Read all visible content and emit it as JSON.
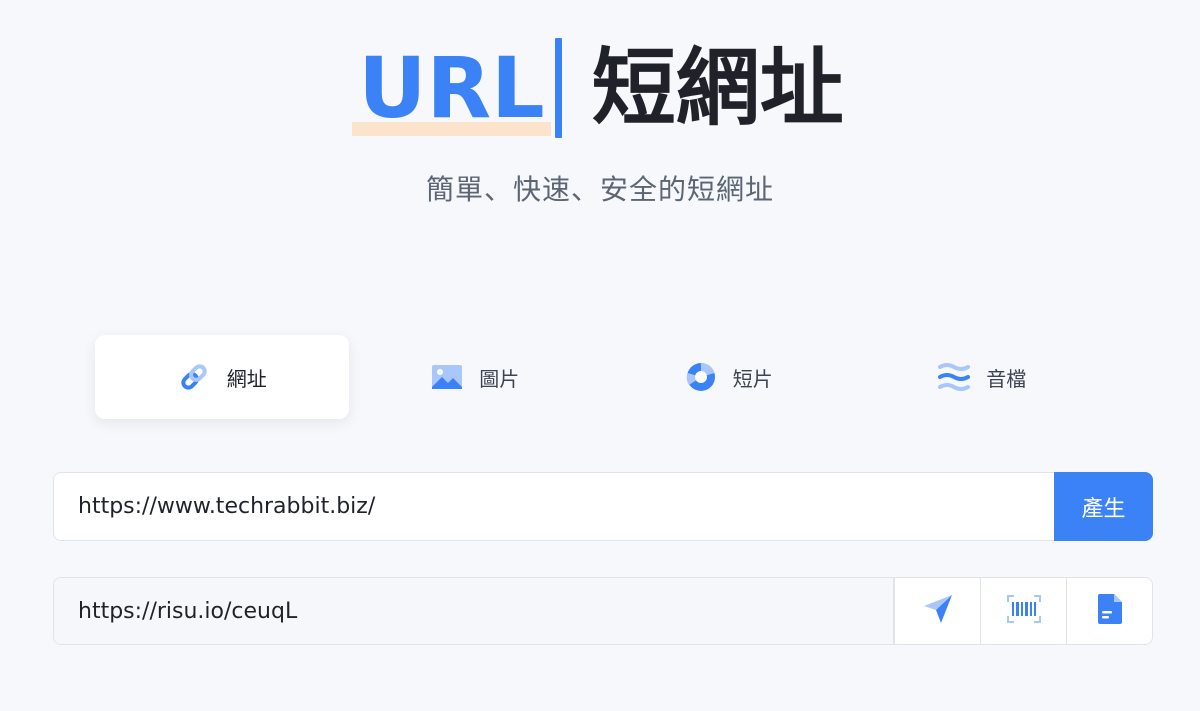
{
  "hero": {
    "title_prefix": "URL",
    "title_main": "短網址",
    "subtitle": "簡單、快速、安全的短網址"
  },
  "tabs": [
    {
      "label": "網址",
      "icon": "link-icon",
      "active": true
    },
    {
      "label": "圖片",
      "icon": "image-icon",
      "active": false
    },
    {
      "label": "短片",
      "icon": "video-icon",
      "active": false
    },
    {
      "label": "音檔",
      "icon": "audio-icon",
      "active": false
    }
  ],
  "form": {
    "url_value": "https://www.techrabbit.biz/",
    "generate_label": "產生"
  },
  "result": {
    "short_url": "https://risu.io/ceuqL",
    "actions": [
      {
        "icon": "send-icon"
      },
      {
        "icon": "barcode-icon"
      },
      {
        "icon": "document-icon"
      }
    ]
  },
  "colors": {
    "accent": "#3b82f6",
    "accent_light": "#a9c7fb",
    "highlight": "#fbe3cc",
    "background": "#f7f8fb"
  }
}
